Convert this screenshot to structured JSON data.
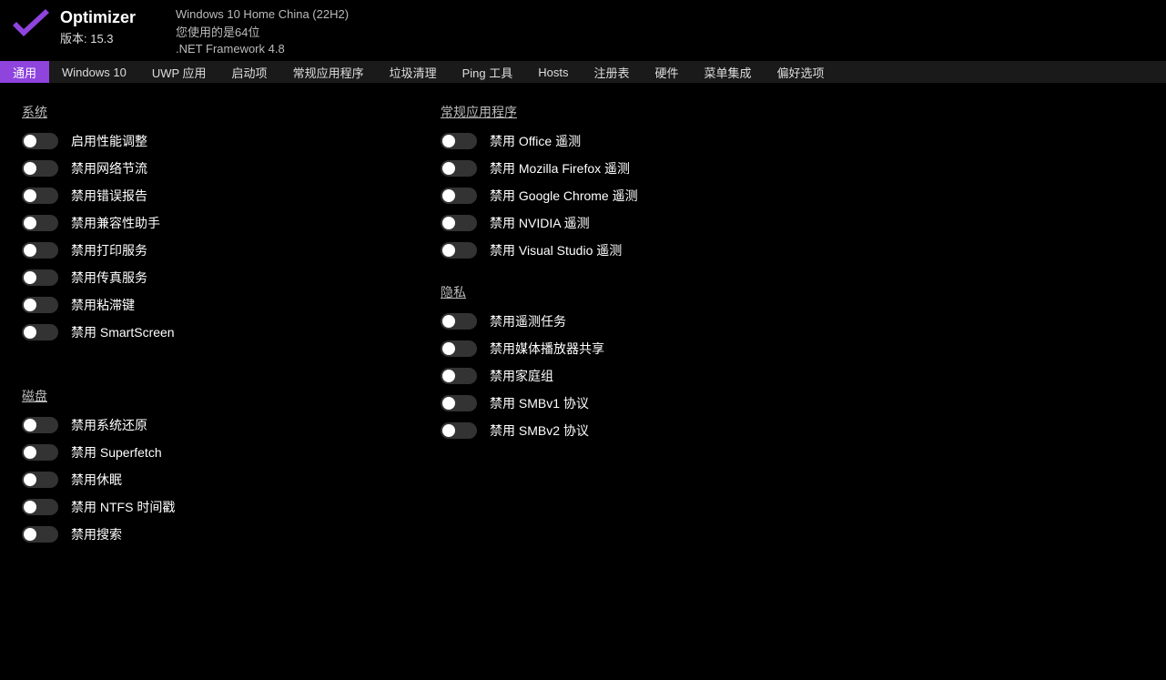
{
  "header": {
    "app_name": "Optimizer",
    "version_label": "版本: 15.3",
    "os_line": "Windows 10 Home China (22H2)",
    "arch_line": "您使用的是64位",
    "dotnet_line": ".NET Framework 4.8"
  },
  "tabs": [
    "通用",
    "Windows 10",
    "UWP 应用",
    "启动项",
    "常规应用程序",
    "垃圾清理",
    "Ping 工具",
    "Hosts",
    "注册表",
    "硬件",
    "菜单集成",
    "偏好选项"
  ],
  "active_tab_index": 0,
  "sections": {
    "system": {
      "title": "系统",
      "items": [
        "启用性能调整",
        "禁用网络节流",
        "禁用错误报告",
        "禁用兼容性助手",
        "禁用打印服务",
        "禁用传真服务",
        "禁用粘滞键",
        "禁用 SmartScreen"
      ]
    },
    "disk": {
      "title": "磁盘",
      "items": [
        "禁用系统还原",
        "禁用 Superfetch",
        "禁用休眠",
        "禁用 NTFS 时间戳",
        "禁用搜索"
      ]
    },
    "apps": {
      "title": "常规应用程序",
      "items": [
        "禁用 Office 遥测",
        "禁用 Mozilla Firefox 遥测",
        "禁用 Google Chrome 遥测",
        "禁用 NVIDIA 遥测",
        "禁用 Visual Studio 遥测"
      ]
    },
    "privacy": {
      "title": "隐私",
      "items": [
        "禁用遥测任务",
        "禁用媒体播放器共享",
        "禁用家庭组",
        "禁用 SMBv1 协议",
        "禁用 SMBv2 协议"
      ]
    }
  },
  "colors": {
    "accent": "#8e44dd"
  }
}
